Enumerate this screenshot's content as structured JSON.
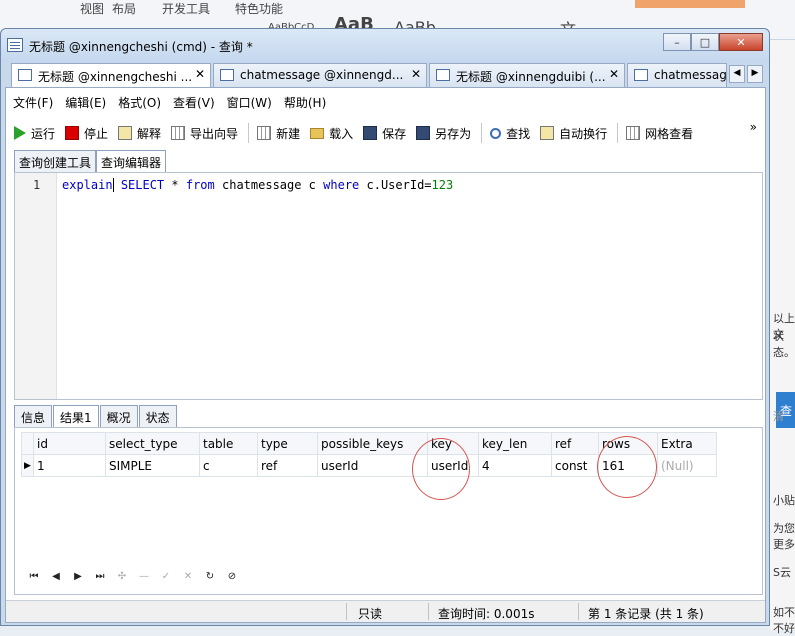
{
  "background_app": {
    "ribbon_items": [
      "视图",
      "布局",
      "开发工具",
      "特色功能",
      "AaBbCcD",
      "AaB",
      "AaBb",
      "文"
    ],
    "side_texts": [
      "以上文",
      "状态。",
      "查",
      "清",
      "小贴",
      "为您",
      "更多",
      "S云",
      "如不",
      "不好"
    ]
  },
  "window": {
    "title": "无标题 @xinnengcheshi (cmd) - 查询 *",
    "buttons": {
      "minimize": "–",
      "maximize": "□",
      "close": "✕"
    }
  },
  "tabs": [
    {
      "label": "无标题 @xinnengcheshi ...",
      "close": "✕",
      "active": true
    },
    {
      "label": "chatmessage @xinnengd...",
      "close": "✕",
      "active": false
    },
    {
      "label": "无标题 @xinnengduibi (...",
      "close": "✕",
      "active": false
    },
    {
      "label": "chatmessage",
      "close": "",
      "active": false
    }
  ],
  "tab_scroll": {
    "left": "◀",
    "right": "▶"
  },
  "menu": [
    "文件(F)",
    "编辑(E)",
    "格式(O)",
    "查看(V)",
    "窗口(W)",
    "帮助(H)"
  ],
  "toolbar": {
    "run": "运行",
    "stop": "停止",
    "explain": "解释",
    "export": "导出向导",
    "new": "新建",
    "load": "载入",
    "save": "保存",
    "save_as": "另存为",
    "find": "查找",
    "wrap": "自动换行",
    "grid_view": "网格查看",
    "more": "»"
  },
  "sub_tabs": [
    "查询创建工具",
    "查询编辑器"
  ],
  "editor": {
    "line_number": "1",
    "tokens": [
      "explain",
      " ",
      "SELECT",
      " * ",
      "from",
      " chatmessage c ",
      "where",
      " c.UserId=",
      "123"
    ]
  },
  "result_tabs": [
    "信息",
    "结果1",
    "概况",
    "状态"
  ],
  "result": {
    "columns": [
      "id",
      "select_type",
      "table",
      "type",
      "possible_keys",
      "key",
      "key_len",
      "ref",
      "rows",
      "Extra"
    ],
    "rows": [
      [
        "1",
        "SIMPLE",
        "c",
        "ref",
        "userId",
        "userId",
        "4",
        "const",
        "161",
        "(Null)"
      ]
    ]
  },
  "nav_icons": [
    "first-record-icon",
    "prev-record-icon",
    "next-record-icon",
    "last-record-icon",
    "add-record-icon",
    "delete-record-icon",
    "apply-icon",
    "discard-icon",
    "refresh-icon",
    "stop-icon"
  ],
  "status": {
    "mode": "只读",
    "query_time": "查询时间: 0.001s",
    "records": "第 1 条记录 (共 1 条)"
  }
}
